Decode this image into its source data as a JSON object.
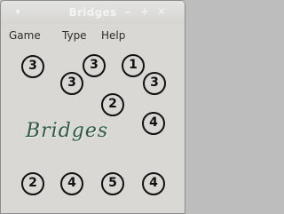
{
  "window": {
    "title": "Bridges"
  },
  "menu": [
    "Game",
    "Type",
    "Help"
  ],
  "logo_text": "Bridges",
  "islands": [
    {
      "value": "3"
    },
    {
      "value": "3"
    },
    {
      "value": "1"
    },
    {
      "value": "3"
    },
    {
      "value": "3"
    },
    {
      "value": "2"
    },
    {
      "value": "4"
    },
    {
      "value": "2"
    },
    {
      "value": "4"
    },
    {
      "value": "5"
    },
    {
      "value": "4"
    }
  ]
}
